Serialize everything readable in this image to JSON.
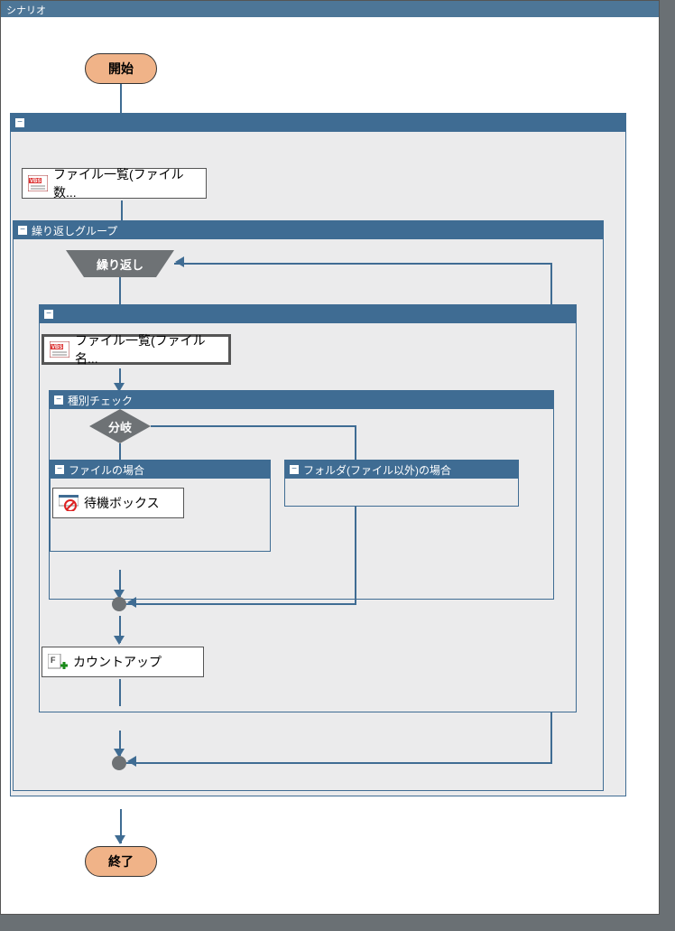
{
  "scenario": {
    "title": "シナリオ",
    "start_label": "開始",
    "end_label": "終了"
  },
  "outer_group": {
    "title": "",
    "file_count_step": "ファイル一覧(ファイル数..."
  },
  "repeat_group": {
    "title": "繰り返しグループ",
    "loop_label": "繰り返し"
  },
  "inner_group": {
    "title": "",
    "file_name_step": "ファイル一覧(ファイル名...",
    "countup_step": "カウントアップ"
  },
  "type_check": {
    "title": "種別チェック",
    "branch_label": "分岐",
    "file_case_title": "ファイルの場合",
    "folder_case_title": "フォルダ(ファイル以外)の場合",
    "wait_step": "待機ボックス"
  },
  "icons": {
    "vbs": "VBS",
    "vbs2": "VBS",
    "prohibit": "⊘",
    "fplus": "F"
  }
}
